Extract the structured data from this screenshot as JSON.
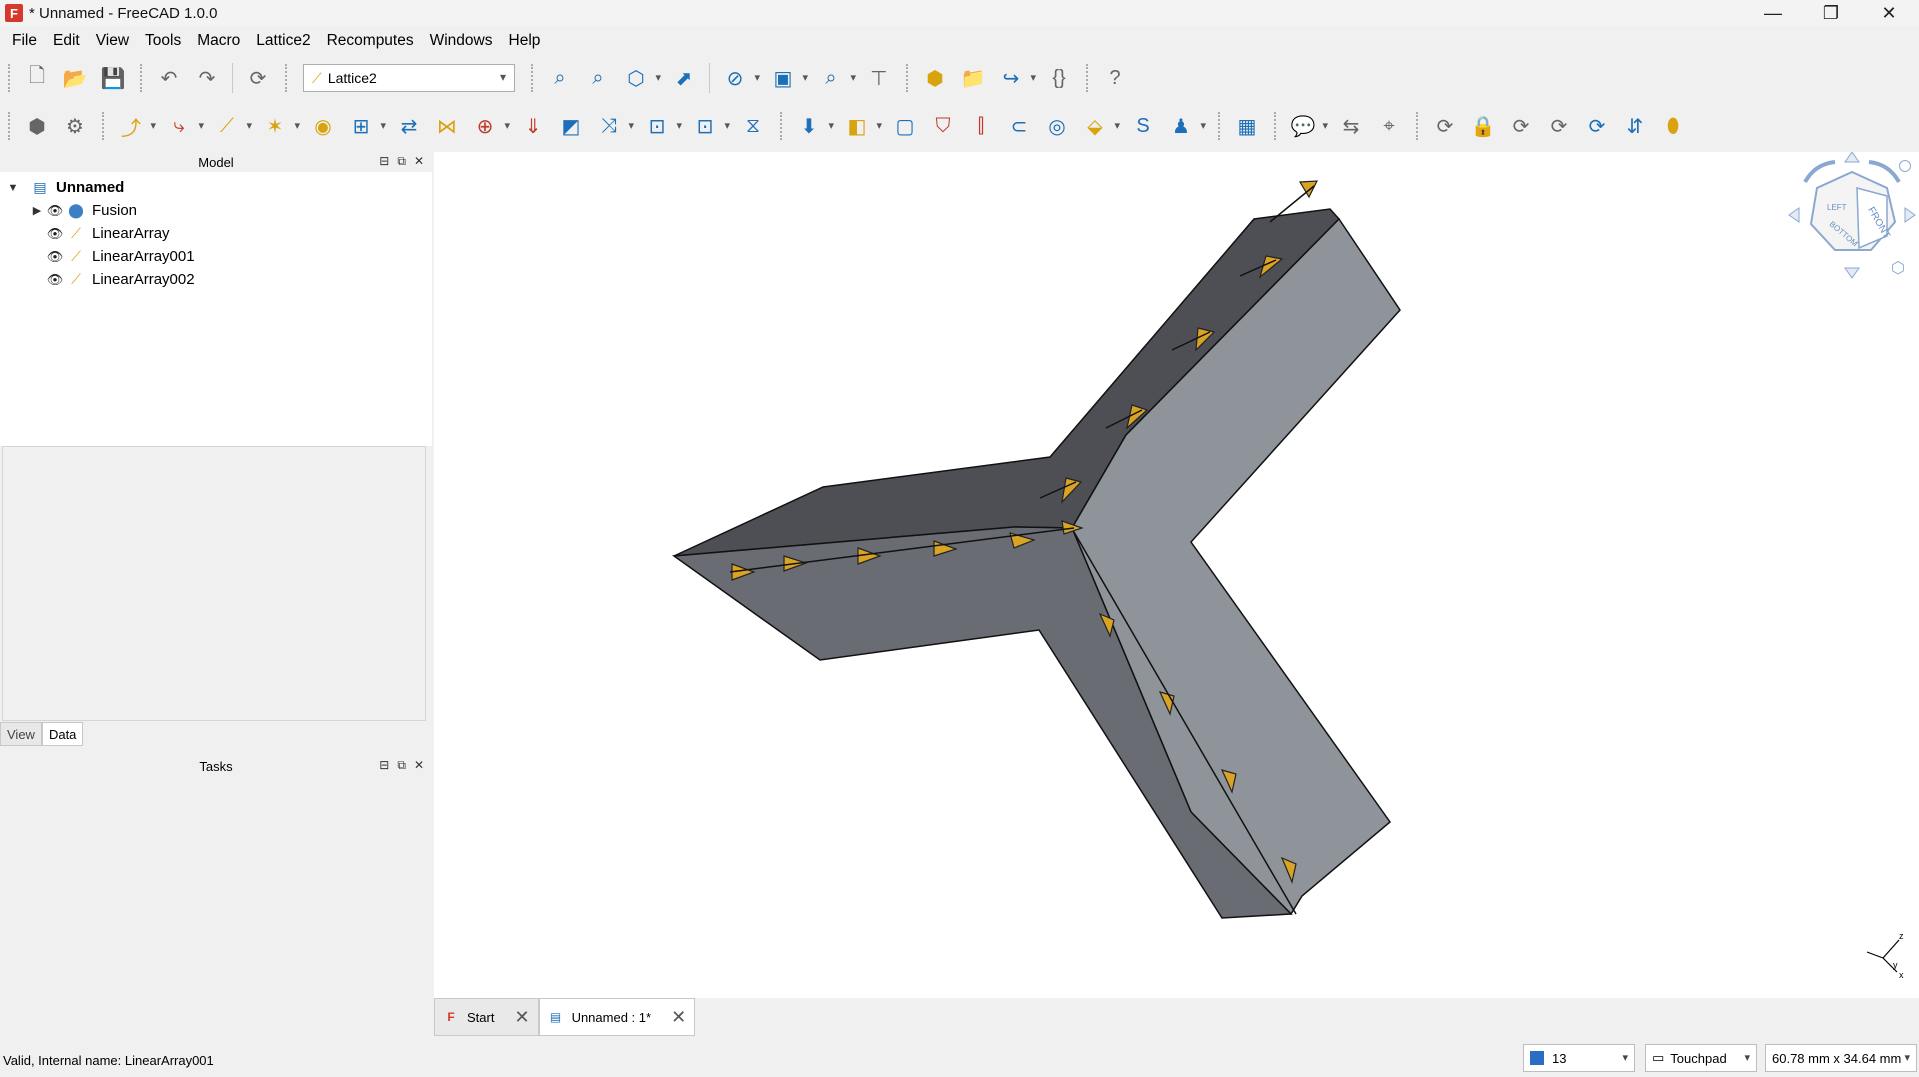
{
  "window": {
    "title": "* Unnamed - FreeCAD 1.0.0",
    "minimize": "—",
    "maximize": "❐",
    "close": "✕"
  },
  "menu": [
    "File",
    "Edit",
    "View",
    "Tools",
    "Macro",
    "Lattice2",
    "Recomputes",
    "Windows",
    "Help"
  ],
  "toolbar": {
    "workbench": "Lattice2"
  },
  "model_panel": {
    "title": "Model",
    "tree": [
      {
        "label": "Unnamed",
        "level": 0,
        "expanded": true
      },
      {
        "label": "Fusion",
        "level": 1,
        "collapsed": true
      },
      {
        "label": "LinearArray",
        "level": 1
      },
      {
        "label": "LinearArray001",
        "level": 1
      },
      {
        "label": "LinearArray002",
        "level": 1
      }
    ]
  },
  "props_panel": {
    "tabs": [
      "View",
      "Data"
    ],
    "active_tab": "Data"
  },
  "tasks_panel": {
    "title": "Tasks"
  },
  "doc_tabs": [
    {
      "label": "Start",
      "active": false
    },
    {
      "label": "Unnamed : 1*",
      "active": true
    }
  ],
  "navcube": {
    "faces": [
      "FRONT",
      "LEFT",
      "BOTTOM"
    ]
  },
  "axis_labels": {
    "z": "z",
    "y": "y",
    "x": "x"
  },
  "status": {
    "message": "Valid, Internal name: LinearArray001",
    "count": "13",
    "nav_style": "Touchpad",
    "dimensions": "60.78 mm x 34.64 mm"
  },
  "colors": {
    "arrow_fill": "#d9a326",
    "face_light": "#8f949a",
    "face_mid": "#696c72",
    "face_dark": "#4d4f55"
  }
}
